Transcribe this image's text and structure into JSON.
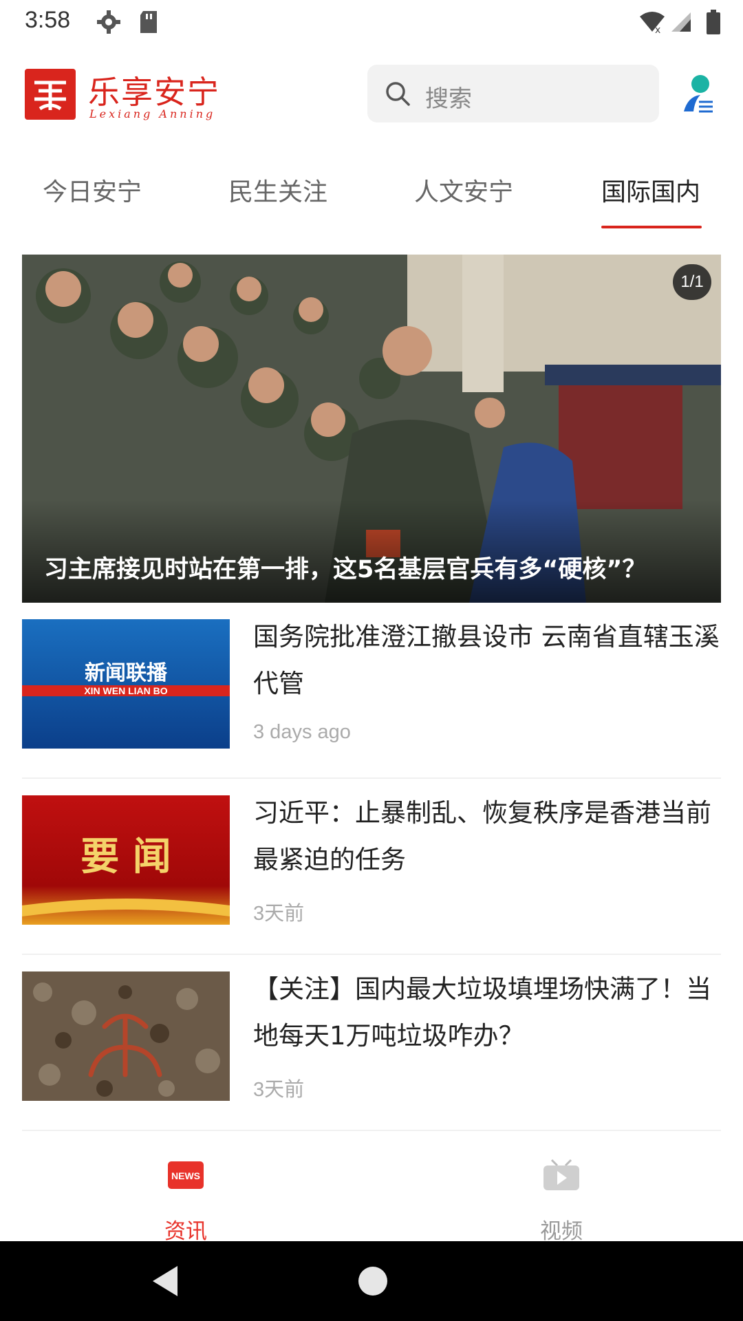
{
  "status_bar": {
    "time": "3:58",
    "icons": [
      "settings-icon",
      "sd-card-icon",
      "wifi-icon",
      "signal-icon",
      "battery-icon"
    ]
  },
  "header": {
    "logo_title": "乐享安宁",
    "logo_subtitle": "Lexiang Anning",
    "search_placeholder": "搜索",
    "brand_color": "#d9251d"
  },
  "tabs": [
    {
      "label": "今日安宁",
      "active": false
    },
    {
      "label": "民生关注",
      "active": false
    },
    {
      "label": "人文安宁",
      "active": false
    },
    {
      "label": "国际国内",
      "active": true
    }
  ],
  "hero": {
    "counter": "1/1",
    "caption": "习主席接见时站在第一排，这5名基层官兵有多“硬核”？"
  },
  "news": [
    {
      "title": "国务院批准澄江撤县设市  云南省直辖玉溪代管",
      "time": "3 days ago",
      "thumb_text": "新闻联播",
      "thumb_subtext": "XIN WEN LIAN BO"
    },
    {
      "title": "习近平：止暴制乱、恢复秩序是香港当前最紧迫的任务",
      "time": "3天前",
      "thumb_text": "要 闻"
    },
    {
      "title": "【关注】国内最大垃圾填埋场快满了！当地每天1万吨垃圾咋办？",
      "time": "3天前"
    }
  ],
  "bottom_nav": [
    {
      "label": "资讯",
      "icon": "news-icon",
      "active": true,
      "badge": "NEWS"
    },
    {
      "label": "视频",
      "icon": "video-icon",
      "active": false
    }
  ],
  "system_nav": [
    "back-icon",
    "home-icon"
  ]
}
